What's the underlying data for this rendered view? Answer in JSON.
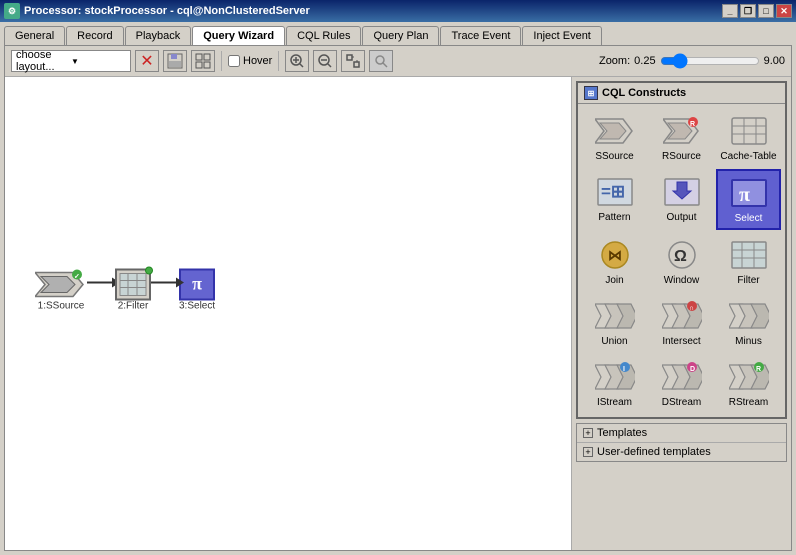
{
  "titleBar": {
    "title": "Processor: stockProcessor - cql@NonClusteredServer",
    "icon": "processor-icon"
  },
  "titleButtons": [
    "minimize",
    "restore",
    "maximize",
    "close"
  ],
  "tabs": [
    {
      "label": "General",
      "id": "general",
      "active": false
    },
    {
      "label": "Record",
      "id": "record",
      "active": false
    },
    {
      "label": "Playback",
      "id": "playback",
      "active": false
    },
    {
      "label": "Query Wizard",
      "id": "query-wizard",
      "active": true
    },
    {
      "label": "CQL Rules",
      "id": "cql-rules",
      "active": false
    },
    {
      "label": "Query Plan",
      "id": "query-plan",
      "active": false
    },
    {
      "label": "Trace Event",
      "id": "trace-event",
      "active": false
    },
    {
      "label": "Inject Event",
      "id": "inject-event",
      "active": false
    }
  ],
  "toolbar": {
    "layoutLabel": "choose layout...",
    "hoverLabel": "Hover",
    "zoomLabel": "Zoom:",
    "zoomMin": "0.25",
    "zoomMax": "9.00"
  },
  "flowNodes": [
    {
      "id": "1",
      "label": "1:SSource",
      "type": "ssource"
    },
    {
      "id": "2",
      "label": "2:Filter",
      "type": "filter"
    },
    {
      "id": "3",
      "label": "3:Select",
      "type": "select"
    }
  ],
  "cqlConstructs": {
    "title": "CQL Constructs",
    "items": [
      {
        "label": "SSource",
        "type": "ssource",
        "selected": false
      },
      {
        "label": "RSource",
        "type": "rsource",
        "selected": false
      },
      {
        "label": "Cache-Table",
        "type": "cache-table",
        "selected": false
      },
      {
        "label": "Pattern",
        "type": "pattern",
        "selected": false
      },
      {
        "label": "Output",
        "type": "output",
        "selected": false
      },
      {
        "label": "Select",
        "type": "select",
        "selected": true
      },
      {
        "label": "Join",
        "type": "join",
        "selected": false
      },
      {
        "label": "Window",
        "type": "window",
        "selected": false
      },
      {
        "label": "Filter",
        "type": "filter",
        "selected": false
      },
      {
        "label": "Union",
        "type": "union",
        "selected": false
      },
      {
        "label": "Intersect",
        "type": "intersect",
        "selected": false
      },
      {
        "label": "Minus",
        "type": "minus",
        "selected": false
      },
      {
        "label": "IStream",
        "type": "istream",
        "selected": false
      },
      {
        "label": "DStream",
        "type": "dstream",
        "selected": false
      },
      {
        "label": "RStream",
        "type": "rstream",
        "selected": false
      }
    ]
  },
  "templates": [
    {
      "label": "Templates"
    },
    {
      "label": "User-defined templates"
    }
  ]
}
